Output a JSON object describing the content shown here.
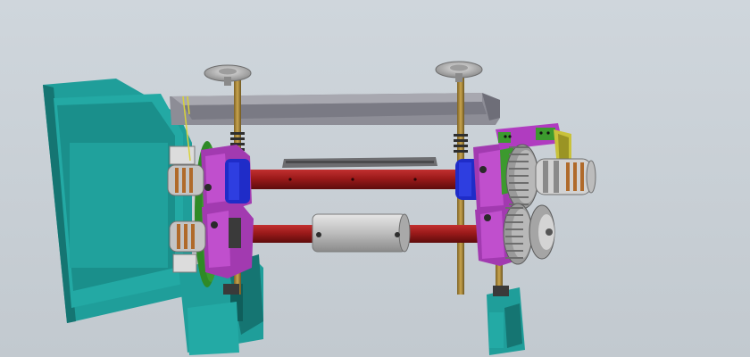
{
  "scene": {
    "kind": "cad-viewport",
    "colors": {
      "background_top": "#cfd6dc",
      "background_bottom": "#c2c9cf",
      "frame_teal": "#1f9e9a",
      "frame_teal_dark": "#157572",
      "frame_teal_light": "#2fb7b2",
      "crossbar_gray": "#8d8d96",
      "handwheel": "#b9b9b9",
      "shaft_red": "#9c1a1a",
      "shaft_red_dark": "#6e0f0f",
      "bearing_purple": "#a23ab0",
      "bearing_magenta": "#c94fc9",
      "collar_blue": "#1f2cc8",
      "gear_green": "#3c9a2e",
      "gear_gray": "#9a9a9a",
      "sleeve_light": "#bdbdbd",
      "screw_bronze": "#a8863a",
      "spring_dark": "#3a3a3a",
      "guide_yellow": "#d8d23a",
      "bracket_purple": "#b03cc0"
    }
  }
}
